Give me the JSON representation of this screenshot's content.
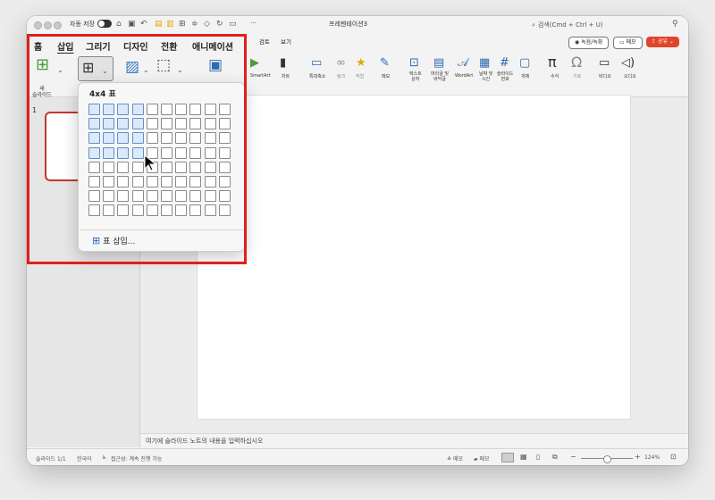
{
  "titlebar": {
    "autosave_label": "자동 저장",
    "doc_title": "프레젠테이션3",
    "search_placeholder": "검색(Cmd + Ctrl + U)",
    "more": "···"
  },
  "tabs": [
    {
      "label": "홈",
      "active": false
    },
    {
      "label": "삽입",
      "active": true
    },
    {
      "label": "그리기",
      "active": false
    },
    {
      "label": "디자인",
      "active": false
    },
    {
      "label": "전환",
      "active": false
    },
    {
      "label": "애니메이션",
      "active": false
    },
    {
      "label": "검토",
      "active": false
    },
    {
      "label": "보기",
      "active": false
    }
  ],
  "ribbon_right": {
    "record": "녹음/녹화",
    "comments": "메모",
    "share": "공유"
  },
  "ribbon": {
    "new_slide": [
      "새",
      "슬라이드"
    ],
    "smartart": "SmartArt",
    "chart": "차트",
    "screenshot": "특대축소",
    "link": "링크",
    "action": "작업",
    "comment": "메모",
    "textbox": [
      "텍스트",
      "상자"
    ],
    "header_footer": [
      "머리글 및",
      "바닥글"
    ],
    "wordart": "WordArt",
    "datetime": [
      "날짜 및",
      "시간"
    ],
    "slide_number": [
      "슬라이드",
      "번호"
    ],
    "object": "개체",
    "equation": "수식",
    "symbol": "기호",
    "video": "비디오",
    "audio": "오디오"
  },
  "thumbnails": {
    "slide_number": "1"
  },
  "notes_placeholder": "여기에 슬라이드 노트의 내용을 입력하십시오",
  "statusbar": {
    "slide_info": "슬라이드 1/1",
    "language": "한국어",
    "accessibility": "접근성: 계속 진행 가능",
    "notes": "메모",
    "comments": "메모",
    "zoom": "124%"
  },
  "table_popup": {
    "title": "4x4 표",
    "selected_rows": 4,
    "selected_cols": 4,
    "grid_rows": 8,
    "grid_cols": 10,
    "insert_table_label": "표 삽입..."
  },
  "colors": {
    "highlight": "#e0201a",
    "share_button": "#e0452b",
    "cell_selected": "#dde9f8"
  }
}
